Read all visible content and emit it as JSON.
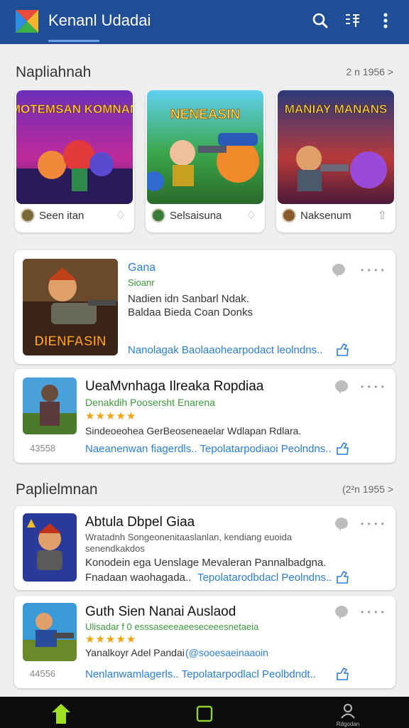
{
  "app": {
    "title": "Kenanl Udadai"
  },
  "header": {
    "icons": [
      "search-icon",
      "grid-icon",
      "more-vert-icon"
    ]
  },
  "section1": {
    "title": "Napliahnah",
    "meta": " 2 n   1956 >"
  },
  "featured": [
    {
      "img_text": "MOTEMSAN KOMNAN",
      "name": "Seen itan",
      "action": "♢"
    },
    {
      "img_text": "NENEASIN",
      "name": "Selsaisuna",
      "action": "♢"
    },
    {
      "img_text": "MANIAY MANANS",
      "name": "Naksenum",
      "action": "⇧"
    }
  ],
  "list1": [
    {
      "title": "Gana",
      "subtitle": "Sioanr",
      "desc1": "Nadien idn Sanbarl Ndak.",
      "desc2": "Baldaa Bieda Coan Donks",
      "link": "Nanolagak Baolaaohearpodact leolndns..",
      "img_text": "DIENFASIN",
      "dots": "• • • •"
    },
    {
      "title": "UeaMvnhaga Ilreaka Ropdiaa",
      "subtitle": "Denakdih Poosersht Enarena",
      "stars": "★★★★★",
      "desc1": "Sindeoeohea GerBeoseneaelar Wdlapan Rdlara.",
      "count": "43558",
      "link": "Naeanenwan fiagerdls.. Tepolatarpodiaoi Peolndns..",
      "dots": "• • • •"
    }
  ],
  "section2": {
    "title": "Paplielmnan",
    "meta": "(2²n   1955 >"
  },
  "list2": [
    {
      "title": "Abtula Dbpel Giaa",
      "desc1": "Wratadnh Songeonenitaaslanlan, kendiang euoida",
      "desc2": "senendkakdos",
      "desc3": "Konodein ega Uenslage Mevaleran Pannalbadgna.",
      "link_prefix": "Fnadaan waohagada..",
      "link": "Tepolatarodbdacl Peolndns..",
      "dots": "• • • •"
    },
    {
      "title": "Guth Sien Nanai Auslaod",
      "subtitle": "Ulisadar f 0 esssaseeeaeeseceeesnetaeia",
      "stars": "★★★★★",
      "desc1_prefix": "Yanalkoyr Adel Pandai",
      "desc1_link": "(@sooesaeinaaoin",
      "count": "44556",
      "link": "Nenlanwamlagerls.. Tepolatarpodlacl Peolbdndt..",
      "dots": "• • • •"
    }
  ],
  "bottom_nav": {
    "items": [
      "home-icon",
      "square-icon",
      "profile-icon"
    ],
    "profile_label": "Rdgodan"
  },
  "colors": {
    "header": "#1f4e96",
    "link": "#2a7fd4",
    "green": "#3a9a3a",
    "star": "#f2a20c",
    "nav_bg": "#0c0c0c",
    "home_active": "#9ee021"
  }
}
